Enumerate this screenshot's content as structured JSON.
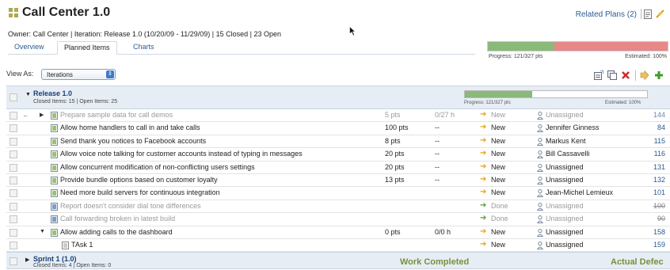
{
  "header": {
    "title": "Call Center 1.0",
    "related_plans": "Related Plans (2)"
  },
  "meta": {
    "line": "Owner: Call Center  |  Iteration: Release 1.0 (10/20/09 - 11/29/09)  | 15 Closed  | 23 Open"
  },
  "tabs": [
    {
      "label": "Overview",
      "active": false
    },
    {
      "label": "Planned Items",
      "active": true
    },
    {
      "label": "Charts",
      "active": false
    }
  ],
  "progress": {
    "label": "Progress: 121/327 pts",
    "estimated": "Estimated: 100%",
    "fraction": 0.37,
    "done_color": "#8ab97a",
    "remaining_color": "#e88787"
  },
  "view_as": {
    "label": "View As:",
    "selected": "Iterations"
  },
  "groups": [
    {
      "name": "Release 1.0",
      "sub": "Closed Items: 15 | Open Items: 25",
      "progress_label": "Progress: 121/327 pts",
      "estimated": "Estimated: 100%",
      "fraction": 0.37
    },
    {
      "name": "Sprint 1 (1.0)",
      "sub": "Closed Items: 4 | Open Items: 0"
    }
  ],
  "rows": [
    {
      "name": "Prepare sample data for call demos",
      "pts": "5 pts",
      "hrs": "0/27 h",
      "status": "New",
      "owner": "Unassigned",
      "num": "144",
      "kind": "story",
      "style": "dim",
      "back": "←",
      "exp": "▶"
    },
    {
      "name": "Allow home handlers to call in and take calls",
      "pts": "100 pts",
      "hrs": "--",
      "status": "New",
      "owner": "Jennifer Ginness",
      "num": "84",
      "kind": "story",
      "style": ""
    },
    {
      "name": "Send thank you notices to Facebook accounts",
      "pts": "8 pts",
      "hrs": "--",
      "status": "New",
      "owner": "Markus Kent",
      "num": "115",
      "kind": "story",
      "style": ""
    },
    {
      "name": "Allow voice note talking for customer accounts instead of typing in messages",
      "pts": "20 pts",
      "hrs": "--",
      "status": "New",
      "owner": "Bill Cassavelli",
      "num": "116",
      "kind": "story",
      "style": ""
    },
    {
      "name": "Allow concurrent modification of non-conflicting users settings",
      "pts": "20 pts",
      "hrs": "--",
      "status": "New",
      "owner": "Unassigned",
      "num": "131",
      "kind": "story",
      "style": ""
    },
    {
      "name": "Provide bundle options based on customer loyalty",
      "pts": "13 pts",
      "hrs": "--",
      "status": "New",
      "owner": "Unassigned",
      "num": "132",
      "kind": "story",
      "style": ""
    },
    {
      "name": "Need more build servers for continuous integration",
      "pts": "",
      "hrs": "",
      "status": "New",
      "owner": "Jean-Michel Lemieux",
      "num": "101",
      "kind": "story",
      "style": ""
    },
    {
      "name": "Report doesn't consider dial tone differences",
      "pts": "",
      "hrs": "",
      "status": "Done",
      "owner": "Unassigned",
      "num": "100",
      "kind": "defect",
      "style": "closed"
    },
    {
      "name": "Call forwarding broken in latest build",
      "pts": "",
      "hrs": "",
      "status": "Done",
      "owner": "Unassigned",
      "num": "90",
      "kind": "defect",
      "style": "closed"
    },
    {
      "name": "Allow adding calls to the dashboard",
      "pts": "0 pts",
      "hrs": "0/0 h",
      "status": "New",
      "owner": "Unassigned",
      "num": "158",
      "kind": "story",
      "style": "",
      "exp": "▼"
    },
    {
      "name": "TAsk 1",
      "pts": "",
      "hrs": "",
      "status": "New",
      "owner": "Unassigned",
      "num": "159",
      "kind": "task",
      "style": "",
      "indent": true
    }
  ],
  "footer": {
    "left": "Work Completed",
    "right": "Actual Defec"
  },
  "icons": {
    "app": "call-center-app-icon",
    "toolbar": [
      "new-plan-icon",
      "duplicate-icon",
      "delete-icon",
      "move-icon",
      "add-icon"
    ]
  }
}
